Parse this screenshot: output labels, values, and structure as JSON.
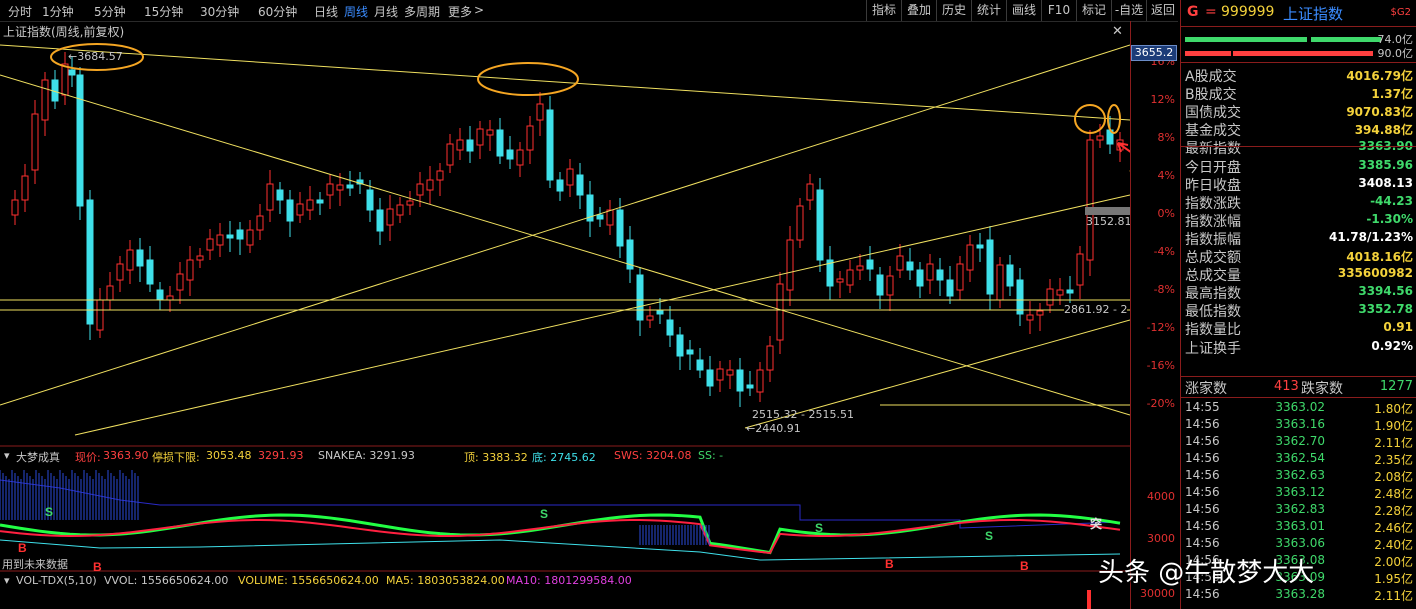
{
  "toolbar": {
    "tabs": [
      "分时",
      "1分钟",
      "5分钟",
      "15分钟",
      "30分钟",
      "60分钟",
      "日线",
      "周线",
      "月线",
      "多周期",
      "更多"
    ],
    "active": "周线",
    "right_buttons": [
      "指标",
      "叠加",
      "历史",
      "统计",
      "画线",
      "F10",
      "标记",
      "-自选",
      "返回"
    ]
  },
  "chart_title": "上证指数(周线,前复权)",
  "price_annotations": {
    "high_label": "3684.57",
    "last_price_tag": "3655.2",
    "right_label": "3152.81",
    "line_label": "2861.92 - 2",
    "low_range": "2515.32 - 2515.51",
    "low_label": "2440.91"
  },
  "percent_axis": [
    "16%",
    "12%",
    "8%",
    "4%",
    "0%",
    "-4%",
    "-8%",
    "-12%",
    "-16%",
    "-20%"
  ],
  "indicator_header": {
    "name": "大梦成真",
    "price_label": "现价:",
    "price_value": "3363.90",
    "stop_label": "停损下限:",
    "stop_value": "3053.48",
    "stop_value2": "3291.93",
    "snake": "SNAKEA: 3291.93",
    "top": "顶: 3383.32",
    "bottom": "底: 2745.62",
    "sws": "SWS: 3204.08",
    "ss": "SS: -"
  },
  "indicator_axis": [
    "4000",
    "3000"
  ],
  "indicator_marks": [
    "S",
    "S",
    "S",
    "S",
    "突",
    "B",
    "B",
    "B",
    "B"
  ],
  "future_data_note": "用到未来数据",
  "volume_header": {
    "name": "VOL-TDX(5,10)",
    "vvol": "VVOL: 1556650624.00",
    "volume": "VOLUME: 1556650624.00",
    "ma5": "MA5: 1803053824.00",
    "ma10": "MA10: 1801299584.00"
  },
  "volume_axis": "30000",
  "side": {
    "code_prefix": "G",
    "code": "999999",
    "name": "上证指数",
    "badge": "$G2",
    "bar1_value": "74.0亿",
    "bar2_value": "90.0亿",
    "stats": [
      {
        "k": "A股成交",
        "v": "4016.79亿",
        "c": "yellow"
      },
      {
        "k": "B股成交",
        "v": "1.37亿",
        "c": "yellow"
      },
      {
        "k": "国债成交",
        "v": "9070.83亿",
        "c": "yellow"
      },
      {
        "k": "基金成交",
        "v": "394.88亿",
        "c": "yellow"
      },
      {
        "k": "最新指数",
        "v": "3363.90",
        "c": "green"
      },
      {
        "k": "今日开盘",
        "v": "3385.96",
        "c": "green"
      },
      {
        "k": "昨日收盘",
        "v": "3408.13",
        "c": "white"
      },
      {
        "k": "指数涨跌",
        "v": "-44.23",
        "c": "green"
      },
      {
        "k": "指数涨幅",
        "v": "-1.30%",
        "c": "green"
      },
      {
        "k": "指数振幅",
        "v": "41.78/1.23%",
        "c": "white"
      },
      {
        "k": "总成交额",
        "v": "4018.16亿",
        "c": "yellow"
      },
      {
        "k": "总成交量",
        "v": "335600982",
        "c": "yellow"
      },
      {
        "k": "最高指数",
        "v": "3394.56",
        "c": "green"
      },
      {
        "k": "最低指数",
        "v": "3352.78",
        "c": "green"
      },
      {
        "k": "指数量比",
        "v": "0.91",
        "c": "yellow"
      },
      {
        "k": "上证换手",
        "v": "0.92%",
        "c": "white"
      }
    ],
    "breadth": {
      "up_label": "涨家数",
      "up": "413",
      "down_label": "跌家数",
      "down": "1277"
    },
    "ticks": [
      {
        "t": "14:55",
        "p": "3363.02",
        "v": "1.80亿"
      },
      {
        "t": "14:56",
        "p": "3363.16",
        "v": "1.90亿"
      },
      {
        "t": "14:56",
        "p": "3362.70",
        "v": "2.11亿"
      },
      {
        "t": "14:56",
        "p": "3362.54",
        "v": "2.35亿"
      },
      {
        "t": "14:56",
        "p": "3362.63",
        "v": "2.08亿"
      },
      {
        "t": "14:56",
        "p": "3363.12",
        "v": "2.48亿"
      },
      {
        "t": "14:56",
        "p": "3362.83",
        "v": "2.28亿"
      },
      {
        "t": "14:56",
        "p": "3363.01",
        "v": "2.46亿"
      },
      {
        "t": "14:56",
        "p": "3363.06",
        "v": "2.40亿"
      },
      {
        "t": "14:56",
        "p": "3363.08",
        "v": "2.00亿"
      },
      {
        "t": "14:56",
        "p": "3363.09",
        "v": "1.95亿"
      },
      {
        "t": "14:56",
        "p": "3363.28",
        "v": "2.11亿"
      }
    ]
  },
  "watermark": "头条 @牛散梦大大",
  "colors": {
    "up": "#ff3030",
    "down": "#3fe0ea",
    "accent": "#3b8cff",
    "line": "#f0e060",
    "highlight": "#f5a623"
  }
}
